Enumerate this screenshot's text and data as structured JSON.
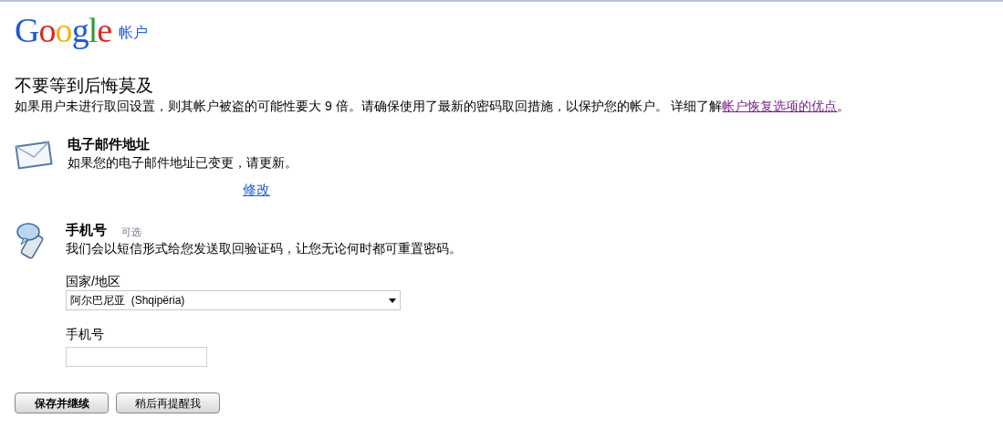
{
  "header": {
    "logo": "Google",
    "product": "帐户"
  },
  "intro": {
    "title": "不要等到后悔莫及",
    "text": "如果用户未进行取回设置，则其帐户被盗的可能性要大 9 倍。请确保使用了最新的密码取回措施，以保护您的帐户。 详细了解",
    "link": "帐户恢复选项的优点",
    "suffix": "。"
  },
  "email": {
    "title": "电子邮件地址",
    "description": "如果您的电子邮件地址已变更，请更新。",
    "edit_link": "修改"
  },
  "phone": {
    "title": "手机号",
    "badge": "可选",
    "description": "我们会以短信形式给您发送取回验证码，让您无论何时都可重置密码。",
    "country_label": "国家/地区",
    "country_value": "阿尔巴尼亚  (Shqipëria)",
    "number_label": "手机号"
  },
  "buttons": [
    {
      "label": "保存并继续",
      "kind": "primary"
    },
    {
      "label": "稍后再提醒我",
      "kind": "secondary"
    }
  ]
}
